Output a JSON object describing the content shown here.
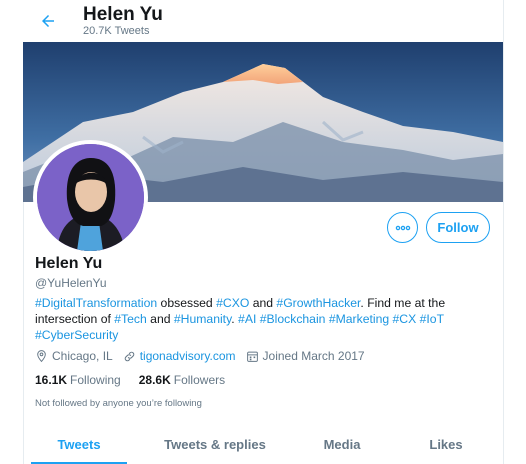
{
  "header": {
    "title": "Helen Yu",
    "tweet_count": "20.7K Tweets"
  },
  "profile": {
    "name": "Helen Yu",
    "handle": "@YuHelenYu",
    "bio": {
      "t1": "#DigitalTransformation",
      "t2": " obsessed ",
      "t3": "#CXO",
      "t4": " and ",
      "t5": "#GrowthHacker",
      "t6": ". Find me at the intersection of ",
      "t7": "#Tech",
      "t8": " and ",
      "t9": "#Humanity",
      "t10": ". ",
      "t11": "#AI",
      "t12": " ",
      "t13": "#Blockchain",
      "t14": " ",
      "t15": "#Marketing",
      "t16": " ",
      "t17": "#CX",
      "t18": " ",
      "t19": "#IoT",
      "t20": " ",
      "t21": "#CyberSecurity"
    },
    "location": "Chicago, IL",
    "website": "tigonadvisory.com",
    "joined": "Joined March 2017",
    "following_count": "16.1K",
    "following_label": "Following",
    "followers_count": "28.6K",
    "followers_label": "Followers",
    "not_followed_text": "Not followed by anyone you’re following"
  },
  "actions": {
    "follow_label": "Follow"
  },
  "tabs": [
    {
      "label": "Tweets",
      "active": true
    },
    {
      "label": "Tweets & replies",
      "active": false
    },
    {
      "label": "Media",
      "active": false
    },
    {
      "label": "Likes",
      "active": false
    }
  ],
  "colors": {
    "accent": "#1da1f2",
    "link": "#1b95e0",
    "secondary_text": "#657786"
  }
}
